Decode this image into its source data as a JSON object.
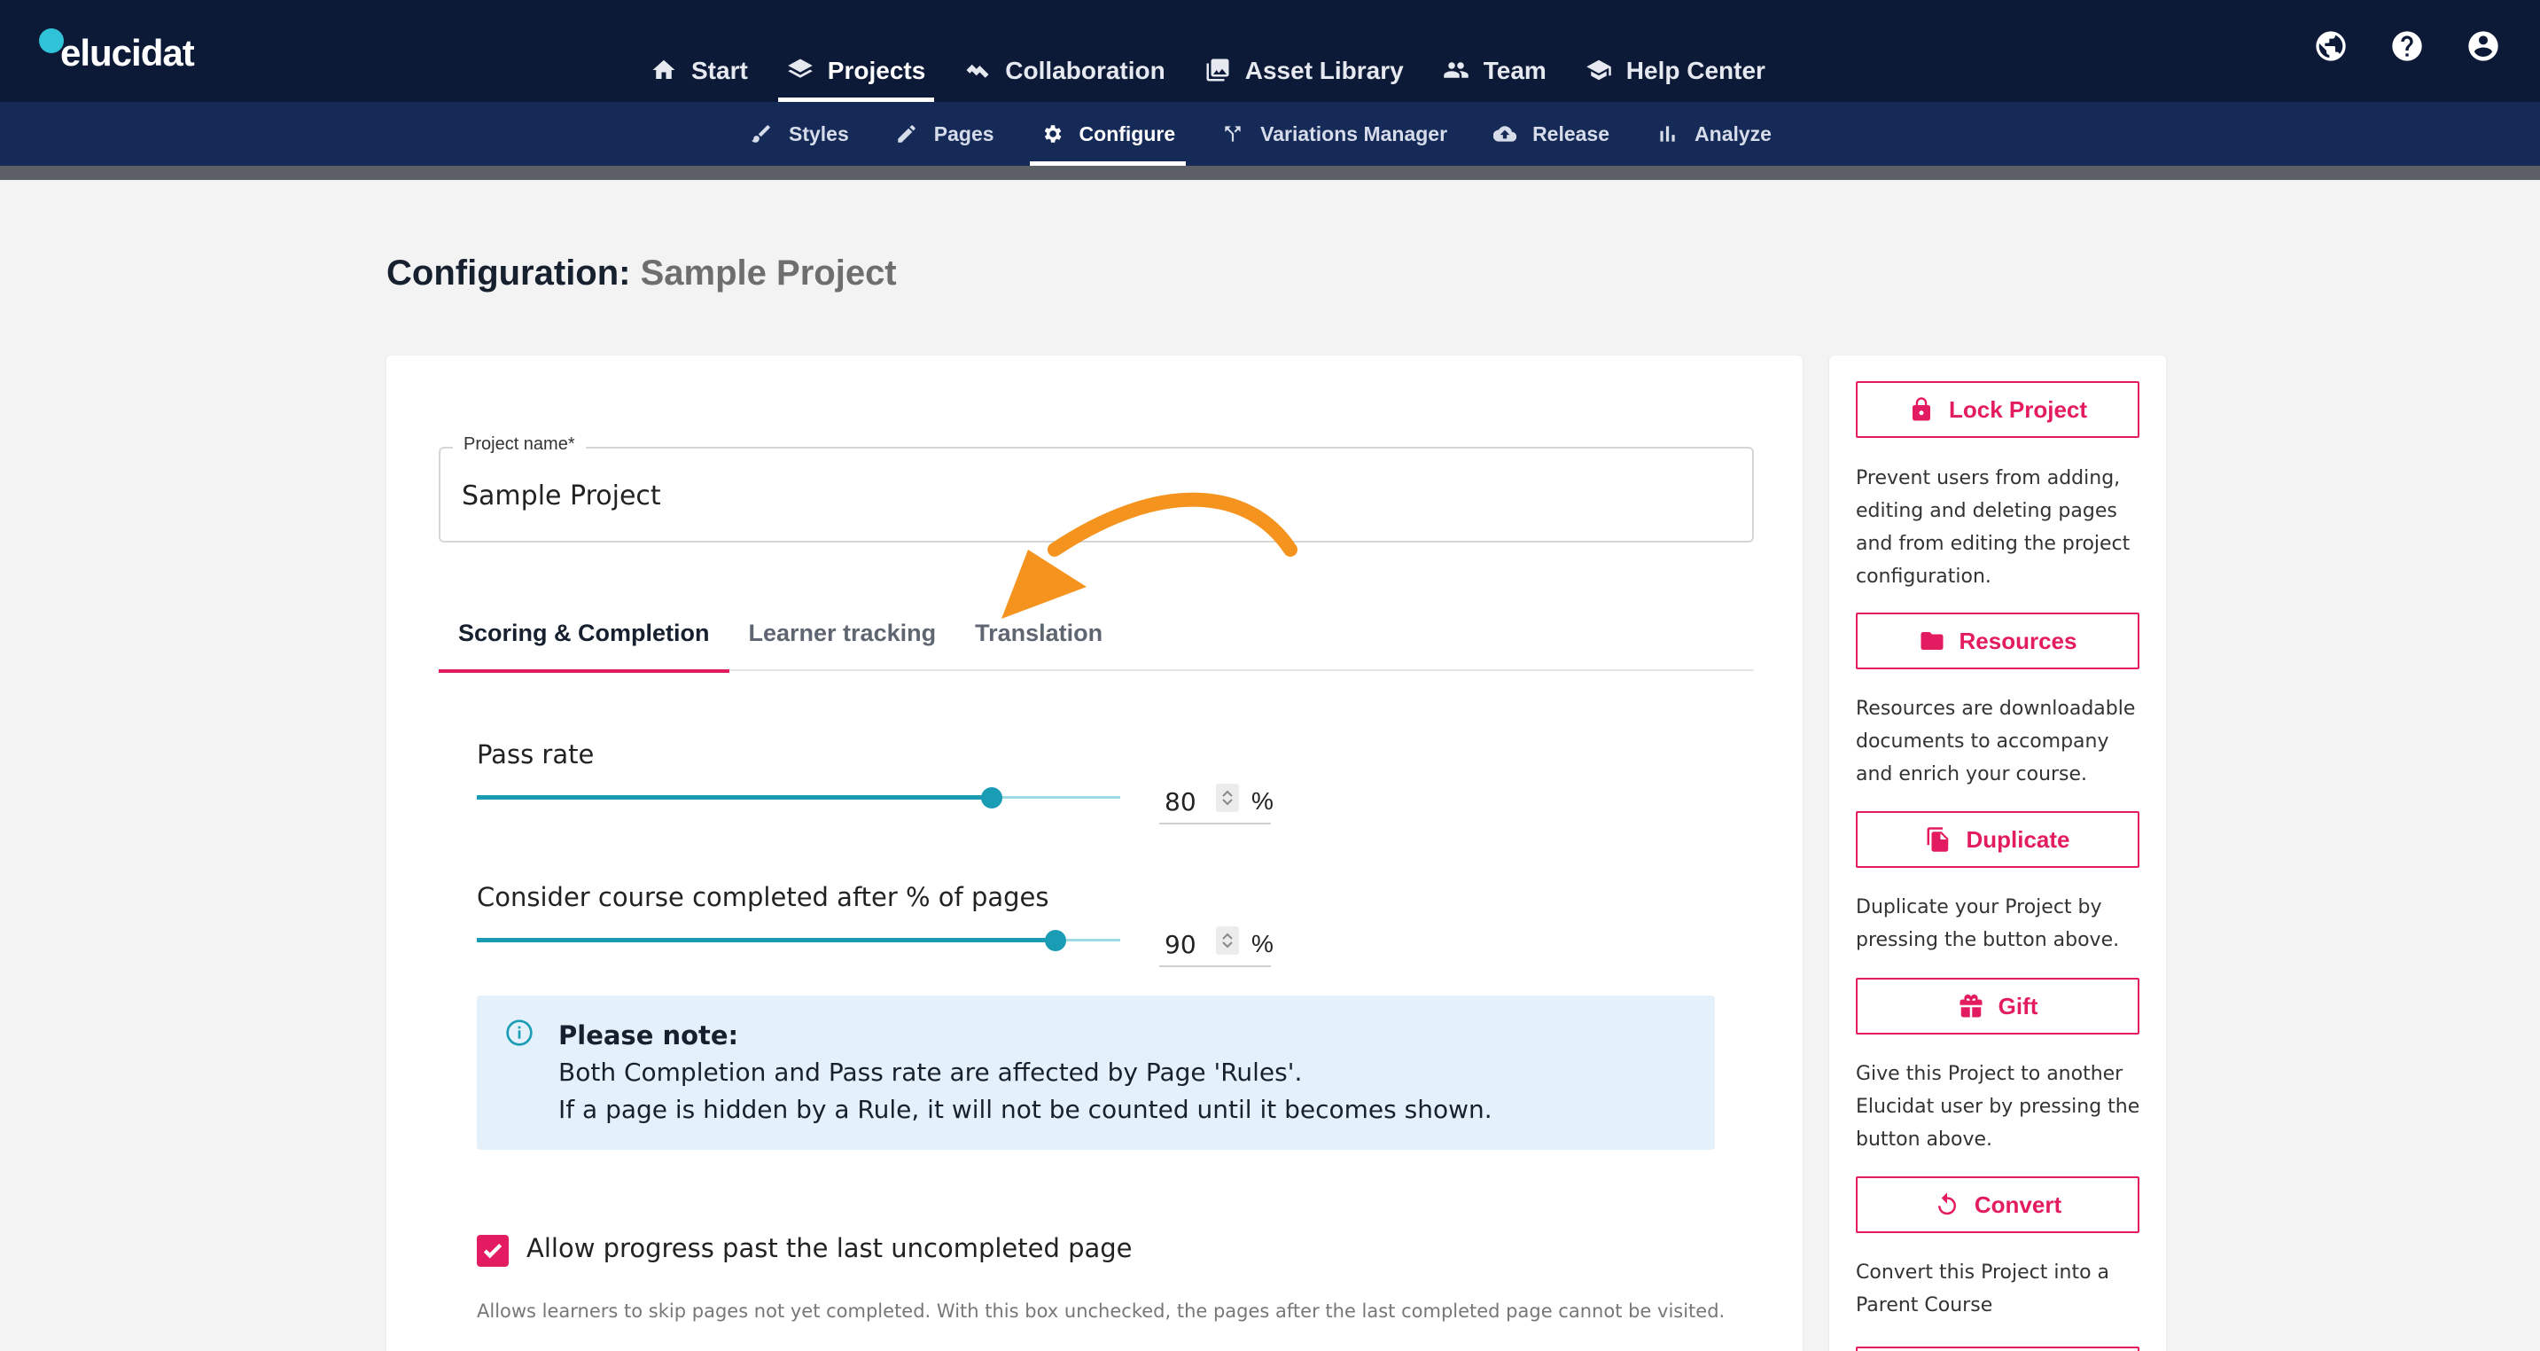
{
  "app": {
    "logo": "elucidat"
  },
  "main_nav": [
    {
      "label": "Start",
      "icon": "home-icon",
      "active": false
    },
    {
      "label": "Projects",
      "icon": "layers-icon",
      "active": true
    },
    {
      "label": "Collaboration",
      "icon": "handshake-icon",
      "active": false
    },
    {
      "label": "Asset Library",
      "icon": "images-icon",
      "active": false
    },
    {
      "label": "Team",
      "icon": "users-icon",
      "active": false
    },
    {
      "label": "Help Center",
      "icon": "graduation-cap-icon",
      "active": false
    }
  ],
  "top_icons": [
    "globe-icon",
    "help-circle-icon",
    "account-icon"
  ],
  "sub_nav": [
    {
      "label": "Styles",
      "icon": "brush-icon",
      "active": false
    },
    {
      "label": "Pages",
      "icon": "pencil-icon",
      "active": false
    },
    {
      "label": "Configure",
      "icon": "gear-icon",
      "active": true
    },
    {
      "label": "Variations Manager",
      "icon": "fork-icon",
      "active": false
    },
    {
      "label": "Release",
      "icon": "cloud-upload-icon",
      "active": false
    },
    {
      "label": "Analyze",
      "icon": "bar-chart-icon",
      "active": false
    }
  ],
  "page": {
    "title_prefix": "Configuration:",
    "title_project": "Sample Project"
  },
  "form": {
    "project_name_label": "Project name",
    "project_name_required": "*",
    "project_name_value": "Sample Project"
  },
  "tabs": [
    {
      "label": "Scoring & Completion",
      "active": true
    },
    {
      "label": "Learner tracking",
      "active": false
    },
    {
      "label": "Translation",
      "active": false
    }
  ],
  "pass_rate": {
    "label": "Pass rate",
    "value": "80",
    "unit": "%",
    "fraction": 0.8
  },
  "completion": {
    "label": "Consider course completed after % of pages",
    "value": "90",
    "unit": "%",
    "fraction": 0.9
  },
  "note": {
    "title": "Please note:",
    "line1": "Both Completion and Pass rate are affected by Page 'Rules'.",
    "line2": "If a page is hidden by a Rule, it will not be counted until it becomes shown."
  },
  "allow_progress": {
    "checked": true,
    "label": "Allow progress past the last uncompleted page",
    "help": "Allows learners to skip pages not yet completed. With this box unchecked, the pages after the last completed page cannot be visited."
  },
  "sidebar": [
    {
      "label": "Lock Project",
      "icon": "lock-icon",
      "desc": "Prevent users from adding, editing and deleting pages and from editing the project configuration."
    },
    {
      "label": "Resources",
      "icon": "folder-icon",
      "desc": "Resources are downloadable documents to accompany and enrich your course."
    },
    {
      "label": "Duplicate",
      "icon": "copy-icon",
      "desc": "Duplicate your Project by pressing the button above."
    },
    {
      "label": "Gift",
      "icon": "gift-icon",
      "desc": "Give this Project to another Elucidat user by pressing the button above."
    },
    {
      "label": "Convert",
      "icon": "convert-icon",
      "desc": "Convert this Project into a Parent Course"
    }
  ],
  "colors": {
    "accent": "#e31c61",
    "nav_bg": "#0c1a37",
    "subnav_bg": "#152a56",
    "slider": "#1a9db4",
    "annotation_arrow": "#f5931f"
  }
}
